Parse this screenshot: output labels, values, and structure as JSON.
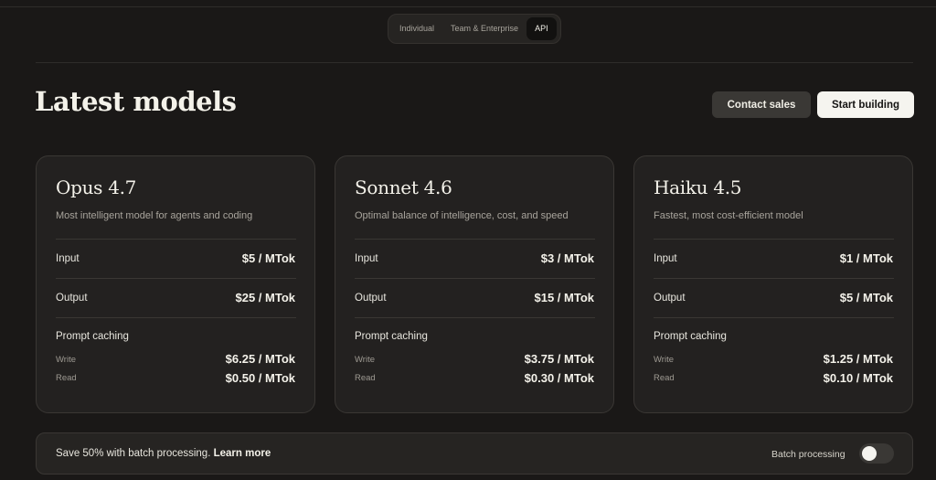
{
  "tabs": [
    {
      "label": "Individual",
      "active": false
    },
    {
      "label": "Team & Enterprise",
      "active": false
    },
    {
      "label": "API",
      "active": true
    }
  ],
  "header": {
    "title": "Latest models",
    "contact_label": "Contact sales",
    "start_label": "Start building"
  },
  "cards": [
    {
      "name": "Opus 4.7",
      "description": "Most intelligent model for agents and coding",
      "input_label": "Input",
      "input_price": "$5 / MTok",
      "output_label": "Output",
      "output_price": "$25 / MTok",
      "caching_label": "Prompt caching",
      "write_label": "Write",
      "write_price": "$6.25 / MTok",
      "read_label": "Read",
      "read_price": "$0.50 / MTok"
    },
    {
      "name": "Sonnet 4.6",
      "description": "Optimal balance of intelligence, cost, and speed",
      "input_label": "Input",
      "input_price": "$3 / MTok",
      "output_label": "Output",
      "output_price": "$15 / MTok",
      "caching_label": "Prompt caching",
      "write_label": "Write",
      "write_price": "$3.75 / MTok",
      "read_label": "Read",
      "read_price": "$0.30 / MTok"
    },
    {
      "name": "Haiku 4.5",
      "description": "Fastest, most cost-efficient model",
      "input_label": "Input",
      "input_price": "$1 / MTok",
      "output_label": "Output",
      "output_price": "$5 / MTok",
      "caching_label": "Prompt caching",
      "write_label": "Write",
      "write_price": "$1.25 / MTok",
      "read_label": "Read",
      "read_price": "$0.10 / MTok"
    }
  ],
  "footer": {
    "text": "Save 50% with batch processing.",
    "link_label": "Learn more",
    "batch_label": "Batch processing",
    "batch_enabled": false
  }
}
